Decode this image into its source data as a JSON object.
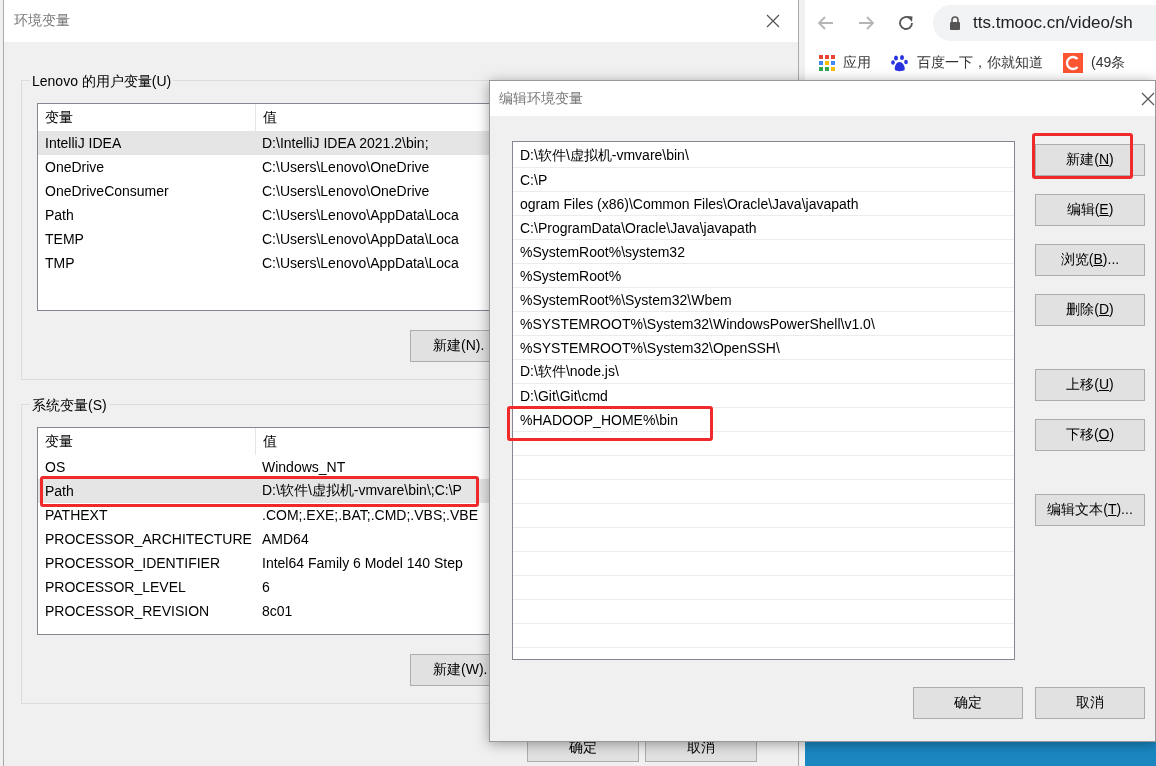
{
  "env_window": {
    "title": "环境变量",
    "user_group": {
      "label": "Lenovo 的用户变量(U)",
      "columns": [
        "变量",
        "值"
      ],
      "rows": [
        {
          "name": "IntelliJ IDEA",
          "value": "D:\\IntelliJ IDEA 2021.2\\bin;",
          "selected": true,
          "highlighted": false
        },
        {
          "name": "OneDrive",
          "value": "C:\\Users\\Lenovo\\OneDrive",
          "selected": false,
          "highlighted": false
        },
        {
          "name": "OneDriveConsumer",
          "value": "C:\\Users\\Lenovo\\OneDrive",
          "selected": false,
          "highlighted": false
        },
        {
          "name": "Path",
          "value": "C:\\Users\\Lenovo\\AppData\\Loca",
          "selected": false,
          "highlighted": false
        },
        {
          "name": "TEMP",
          "value": "C:\\Users\\Lenovo\\AppData\\Loca",
          "selected": false,
          "highlighted": false
        },
        {
          "name": "TMP",
          "value": "C:\\Users\\Lenovo\\AppData\\Loca",
          "selected": false,
          "highlighted": false
        }
      ],
      "new_button": "新建(N)."
    },
    "system_group": {
      "label": "系统变量(S)",
      "columns": [
        "变量",
        "值"
      ],
      "rows": [
        {
          "name": "OS",
          "value": "Windows_NT",
          "selected": false,
          "highlighted": false
        },
        {
          "name": "Path",
          "value": "D:\\软件\\虚拟机-vmvare\\bin\\;C:\\P",
          "selected": true,
          "highlighted": true
        },
        {
          "name": "PATHEXT",
          "value": ".COM;.EXE;.BAT;.CMD;.VBS;.VBE",
          "selected": false,
          "highlighted": false
        },
        {
          "name": "PROCESSOR_ARCHITECTURE",
          "value": "AMD64",
          "selected": false,
          "highlighted": false
        },
        {
          "name": "PROCESSOR_IDENTIFIER",
          "value": "Intel64 Family 6 Model 140 Step",
          "selected": false,
          "highlighted": false
        },
        {
          "name": "PROCESSOR_LEVEL",
          "value": "6",
          "selected": false,
          "highlighted": false
        },
        {
          "name": "PROCESSOR_REVISION",
          "value": "8c01",
          "selected": false,
          "highlighted": false
        }
      ],
      "new_button": "新建(W)."
    },
    "buttons": [
      "确定",
      "取消"
    ]
  },
  "browser": {
    "url": "tts.tmooc.cn/video/sh",
    "bookmarks": [
      {
        "kind": "apps",
        "label": "应用"
      },
      {
        "kind": "baidu",
        "label": "百度一下，你就知道"
      },
      {
        "kind": "csdn",
        "label": "(49条"
      }
    ]
  },
  "edit_dialog": {
    "title": "编辑环境变量",
    "entries": [
      {
        "text": "D:\\软件\\虚拟机-vmvare\\bin\\",
        "highlighted": false
      },
      {
        "text": "C:\\P",
        "highlighted": false
      },
      {
        "text": "ogram Files (x86)\\Common Files\\Oracle\\Java\\javapath",
        "highlighted": false
      },
      {
        "text": "C:\\ProgramData\\Oracle\\Java\\javapath",
        "highlighted": false
      },
      {
        "text": "%SystemRoot%\\system32",
        "highlighted": false
      },
      {
        "text": "%SystemRoot%",
        "highlighted": false
      },
      {
        "text": "%SystemRoot%\\System32\\Wbem",
        "highlighted": false
      },
      {
        "text": "%SYSTEMROOT%\\System32\\WindowsPowerShell\\v1.0\\",
        "highlighted": false
      },
      {
        "text": "%SYSTEMROOT%\\System32\\OpenSSH\\",
        "highlighted": false
      },
      {
        "text": "D:\\软件\\node.js\\",
        "highlighted": false
      },
      {
        "text": "D:\\Git\\Git\\cmd",
        "highlighted": false
      },
      {
        "text": "%HADOOP_HOME%\\bin",
        "highlighted": true
      }
    ],
    "button_groups": [
      [
        {
          "label": "新建(",
          "hotkey": "N",
          "suffix": ")",
          "highlighted": true
        },
        {
          "label": "编辑(",
          "hotkey": "E",
          "suffix": ")",
          "highlighted": false
        },
        {
          "label": "浏览(",
          "hotkey": "B",
          "suffix": ")...",
          "highlighted": false
        },
        {
          "label": "删除(",
          "hotkey": "D",
          "suffix": ")",
          "highlighted": false
        }
      ],
      [
        {
          "label": "上移(",
          "hotkey": "U",
          "suffix": ")",
          "highlighted": false
        },
        {
          "label": "下移(",
          "hotkey": "O",
          "suffix": ")",
          "highlighted": false
        }
      ],
      [
        {
          "label": "编辑文本(",
          "hotkey": "T",
          "suffix": ")...",
          "highlighted": false
        }
      ]
    ],
    "footer_buttons": [
      "确定",
      "取消"
    ]
  }
}
